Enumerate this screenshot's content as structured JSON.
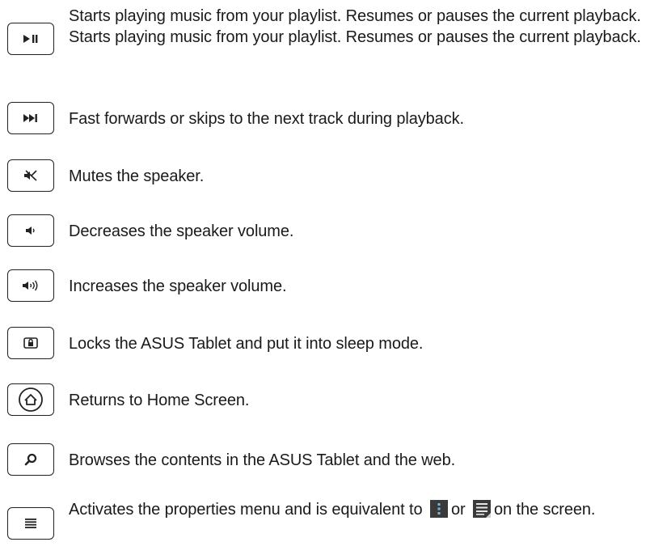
{
  "keys": [
    {
      "icon": "play-pause-icon",
      "description": "Starts playing music from your playlist. Resumes or pauses the current playback. Starts playing music from your playlist. Resumes or pauses the current playback."
    },
    {
      "icon": "skip-forward-icon",
      "description": "Fast forwards or skips to the next track during playback."
    },
    {
      "icon": "mute-icon",
      "description": "Mutes the speaker."
    },
    {
      "icon": "volume-down-icon",
      "description": "Decreases the speaker volume."
    },
    {
      "icon": "volume-up-icon",
      "description": "Increases the speaker volume."
    },
    {
      "icon": "lock-icon",
      "description": "Locks the ASUS Tablet and put it into sleep mode."
    },
    {
      "icon": "home-icon",
      "description": "Returns to Home Screen."
    },
    {
      "icon": "search-icon",
      "description": "Browses the contents in the ASUS Tablet and the web."
    },
    {
      "icon": "menu-icon",
      "description_before": "Activates the properties menu and is equivalent to",
      "description_or": "or",
      "description_after": "on the screen."
    }
  ]
}
